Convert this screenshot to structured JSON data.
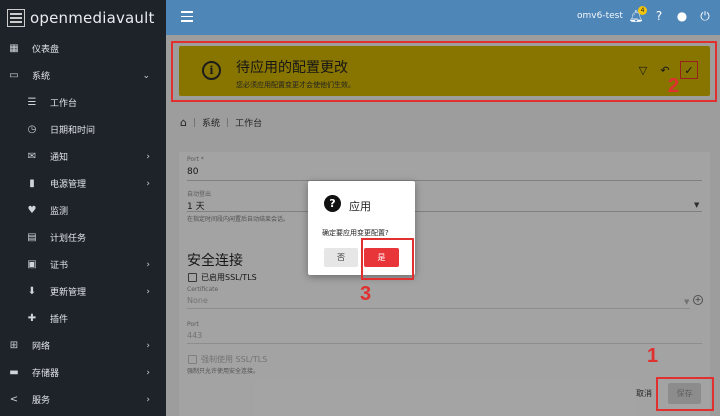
{
  "app": {
    "title": "openmediavault"
  },
  "topbar": {
    "hostname": "omv6-test",
    "notification_count": "4"
  },
  "sidebar": {
    "items": [
      {
        "label": "仪表盘",
        "icon": "dashboard-icon"
      },
      {
        "label": "系统",
        "icon": "laptop-icon"
      },
      {
        "label": "工作台",
        "icon": "sliders-icon"
      },
      {
        "label": "日期和时间",
        "icon": "clock-icon"
      },
      {
        "label": "通知",
        "icon": "mail-icon"
      },
      {
        "label": "电源管理",
        "icon": "power-icon"
      },
      {
        "label": "监测",
        "icon": "heartbeat-icon"
      },
      {
        "label": "计划任务",
        "icon": "calendar-icon"
      },
      {
        "label": "证书",
        "icon": "certificate-icon"
      },
      {
        "label": "更新管理",
        "icon": "download-icon"
      },
      {
        "label": "插件",
        "icon": "puzzle-icon"
      },
      {
        "label": "网络",
        "icon": "network-icon"
      },
      {
        "label": "存储器",
        "icon": "storage-icon"
      },
      {
        "label": "服务",
        "icon": "share-icon"
      }
    ]
  },
  "banner": {
    "title": "待应用的配置更改",
    "subtitle": "您必须应用配置变更才会使他们生效。"
  },
  "breadcrumb": {
    "level1": "系统",
    "level2": "工作台"
  },
  "form": {
    "port_label": "Port *",
    "port_value": "80",
    "timeout_label": "自动登出",
    "timeout_value": "1 天",
    "timeout_hint": "在指定时间段内闲置后自动结束会话。",
    "secure_title": "安全连接",
    "ssl_label": "已启用SSL/TLS",
    "cert_label": "Certificate",
    "cert_value": "None",
    "ssl_port_label": "Port",
    "ssl_port_value": "443",
    "force_ssl_label": "强制使用 SSL/TLS",
    "force_ssl_hint": "强制只允许使用安全连接。"
  },
  "actions": {
    "cancel": "取消",
    "save": "保存"
  },
  "dialog": {
    "title": "应用",
    "message": "确定要应用变更配置?",
    "no": "否",
    "yes": "是"
  },
  "annotations": {
    "step1": "1",
    "step2": "2",
    "step3": "3"
  },
  "colors": {
    "accent": "#4e86b8",
    "banner": "#c9ad00",
    "danger": "#e8353a",
    "annotation": "#e03030"
  }
}
